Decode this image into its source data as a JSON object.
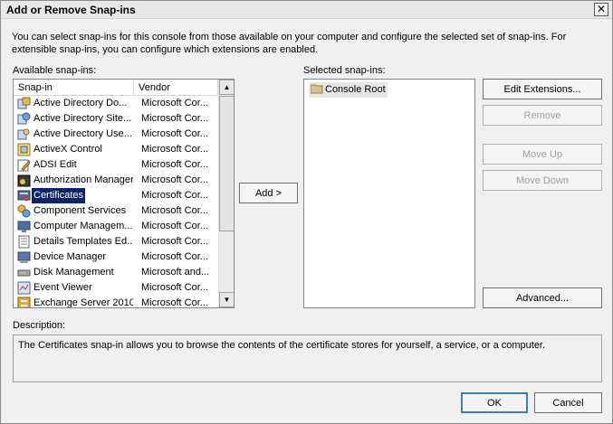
{
  "window": {
    "title": "Add or Remove Snap-ins",
    "close_glyph": "✕"
  },
  "intro_text": "You can select snap-ins for this console from those available on your computer and configure the selected set of snap-ins. For extensible snap-ins, you can configure which extensions are enabled.",
  "available": {
    "label": "Available snap-ins:",
    "columns": {
      "snapin": "Snap-in",
      "vendor": "Vendor"
    },
    "items": [
      {
        "name": "Active Directory Do...",
        "vendor": "Microsoft Cor...",
        "icon": "ad-domains-icon"
      },
      {
        "name": "Active Directory Site...",
        "vendor": "Microsoft Cor...",
        "icon": "ad-sites-icon"
      },
      {
        "name": "Active Directory Use...",
        "vendor": "Microsoft Cor...",
        "icon": "ad-users-icon"
      },
      {
        "name": "ActiveX Control",
        "vendor": "Microsoft Cor...",
        "icon": "activex-icon"
      },
      {
        "name": "ADSI Edit",
        "vendor": "Microsoft Cor...",
        "icon": "adsi-edit-icon"
      },
      {
        "name": "Authorization Manager",
        "vendor": "Microsoft Cor...",
        "icon": "authorization-icon"
      },
      {
        "name": "Certificates",
        "vendor": "Microsoft Cor...",
        "icon": "certificate-icon",
        "selected": true
      },
      {
        "name": "Component Services",
        "vendor": "Microsoft Cor...",
        "icon": "component-services-icon"
      },
      {
        "name": "Computer Managem...",
        "vendor": "Microsoft Cor...",
        "icon": "computer-management-icon"
      },
      {
        "name": "Details Templates Ed...",
        "vendor": "Microsoft Cor...",
        "icon": "templates-icon"
      },
      {
        "name": "Device Manager",
        "vendor": "Microsoft Cor...",
        "icon": "device-manager-icon"
      },
      {
        "name": "Disk Management",
        "vendor": "Microsoft and...",
        "icon": "disk-icon"
      },
      {
        "name": "Event Viewer",
        "vendor": "Microsoft Cor...",
        "icon": "event-viewer-icon"
      },
      {
        "name": "Exchange Server 2010",
        "vendor": "Microsoft Cor...",
        "icon": "exchange-icon"
      }
    ],
    "scroll_up_glyph": "▲",
    "scroll_down_glyph": "▼"
  },
  "add_button": "Add >",
  "selected": {
    "label": "Selected snap-ins:",
    "items": [
      {
        "name": "Console Root",
        "icon": "folder-icon"
      }
    ]
  },
  "buttons": {
    "edit_extensions": "Edit Extensions...",
    "remove": "Remove",
    "move_up": "Move Up",
    "move_down": "Move Down",
    "advanced": "Advanced...",
    "ok": "OK",
    "cancel": "Cancel"
  },
  "description": {
    "label": "Description:",
    "text": "The Certificates snap-in allows you to browse the contents of the certificate stores for yourself, a service, or a computer."
  },
  "colors": {
    "selection": "#0a246a",
    "disabled_text": "#a0a0a0",
    "window_bg": "#f0f0f0"
  }
}
